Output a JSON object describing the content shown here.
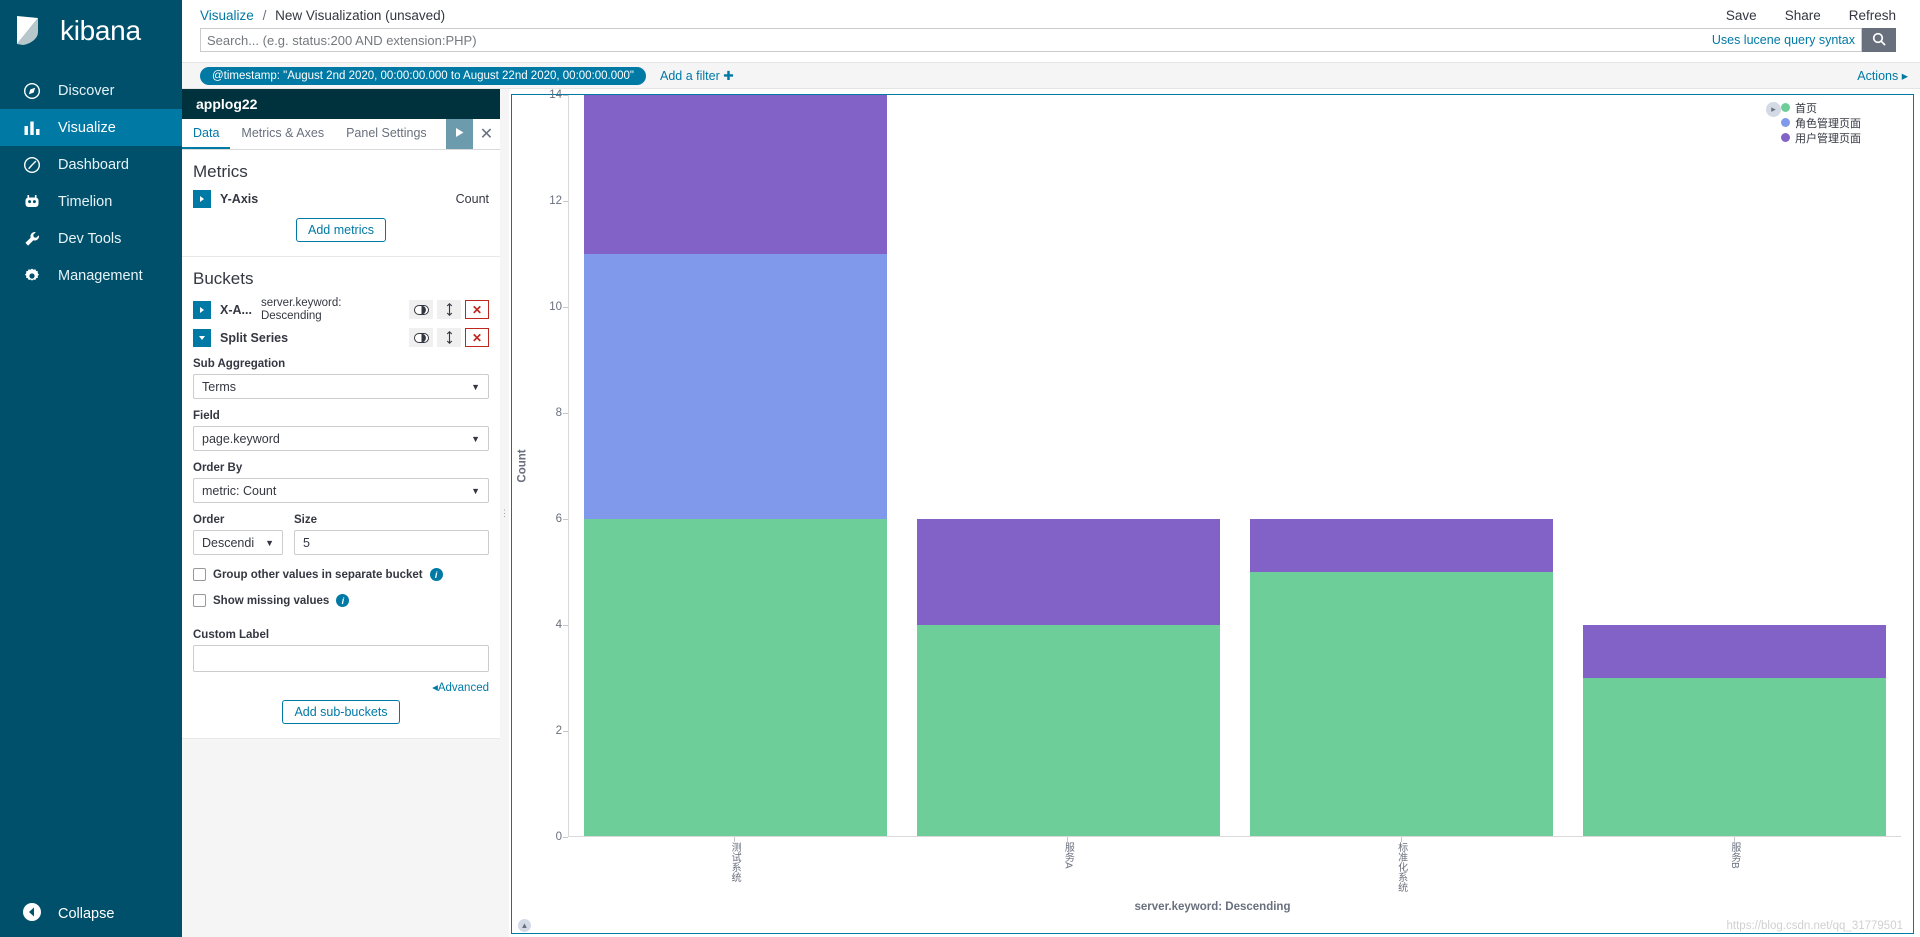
{
  "brand": {
    "name": "kibana"
  },
  "sidebar": {
    "items": [
      {
        "label": "Discover",
        "icon": "compass-icon",
        "active": false
      },
      {
        "label": "Visualize",
        "icon": "bar-chart-icon",
        "active": true
      },
      {
        "label": "Dashboard",
        "icon": "dashboard-icon",
        "active": false
      },
      {
        "label": "Timelion",
        "icon": "timelion-icon",
        "active": false
      },
      {
        "label": "Dev Tools",
        "icon": "wrench-icon",
        "active": false
      },
      {
        "label": "Management",
        "icon": "gear-icon",
        "active": false
      }
    ],
    "collapse_label": "Collapse"
  },
  "header": {
    "breadcrumb_root": "Visualize",
    "breadcrumb_sep": "/",
    "breadcrumb_current": "New Visualization (unsaved)",
    "actions": [
      "Save",
      "Share",
      "Refresh"
    ]
  },
  "search": {
    "value": "",
    "placeholder": "Search... (e.g. status:200 AND extension:PHP)",
    "lucene_hint": "Uses lucene query syntax",
    "search_icon": "magnifier-icon"
  },
  "filterbar": {
    "filter_pill": "@timestamp: \"August 2nd 2020, 00:00:00.000 to August 22nd 2020, 00:00:00.000\"",
    "add_filter": "Add a filter",
    "add_filter_icon": "plus-icon",
    "actions": "Actions",
    "actions_icon": "chevron-right-icon"
  },
  "editor": {
    "index_title": "applog22",
    "tabs": [
      {
        "label": "Data",
        "active": true
      },
      {
        "label": "Metrics & Axes",
        "active": false
      },
      {
        "label": "Panel Settings",
        "active": false
      }
    ],
    "apply_icon": "play-icon",
    "close_icon": "close-icon",
    "metrics": {
      "heading": "Metrics",
      "y_axis_label": "Y-Axis",
      "y_axis_value": "Count",
      "add_metrics_label": "Add metrics",
      "expand_icon": "chevron-right-icon"
    },
    "buckets": {
      "heading": "Buckets",
      "x_axis": {
        "name": "X-A...",
        "detail": "server.keyword: Descending",
        "expand_icon": "chevron-right-icon",
        "toggle_icon": "eye-toggle-icon",
        "move_icon": "updown-arrows-icon",
        "remove_icon": "x-icon"
      },
      "split_series": {
        "name": "Split Series",
        "expand_icon": "chevron-down-icon",
        "toggle_icon": "eye-toggle-icon",
        "move_icon": "updown-arrows-icon",
        "remove_icon": "x-icon"
      },
      "sub_aggregation_label": "Sub Aggregation",
      "sub_aggregation_value": "Terms",
      "field_label": "Field",
      "field_value": "page.keyword",
      "order_by_label": "Order By",
      "order_by_value": "metric: Count",
      "order_label": "Order",
      "order_value": "Descendi",
      "size_label": "Size",
      "size_value": "5",
      "group_other_label": "Group other values in separate bucket",
      "show_missing_label": "Show missing values",
      "custom_label_label": "Custom Label",
      "custom_label_value": "",
      "advanced_label": "Advanced",
      "advanced_icon": "chevron-left-icon",
      "add_sub_buckets_label": "Add sub-buckets"
    }
  },
  "chart_data": {
    "type": "bar",
    "stacked": true,
    "title": "",
    "xlabel": "server.keyword: Descending",
    "ylabel": "Count",
    "categories": [
      "测试系统",
      "服务A",
      "标准化系统",
      "服务B"
    ],
    "yticks": [
      0,
      2,
      4,
      6,
      8,
      10,
      12,
      14
    ],
    "ylim": [
      0,
      14
    ],
    "grid": false,
    "legend_position": "top-right",
    "series": [
      {
        "name": "首页",
        "color": "#6ECE9A",
        "values": [
          6,
          4,
          5,
          3
        ]
      },
      {
        "name": "角色管理页面",
        "color": "#8199EA",
        "values": [
          5,
          0,
          0,
          0
        ]
      },
      {
        "name": "用户管理页面",
        "color": "#8362C8",
        "values": [
          3,
          2,
          1,
          1
        ]
      }
    ],
    "totals": [
      14,
      6,
      6,
      4
    ]
  },
  "chart_panel": {
    "legend_collapse_icon": "chevron-right-icon",
    "expand_icon": "chevron-up-icon"
  },
  "watermark": "https://blog.csdn.net/qq_31779501",
  "colors": {
    "accent": "#0079a5",
    "sidebar_bg": "#00506b",
    "panel_title_bg": "#00323d",
    "danger": "#bd271e"
  }
}
